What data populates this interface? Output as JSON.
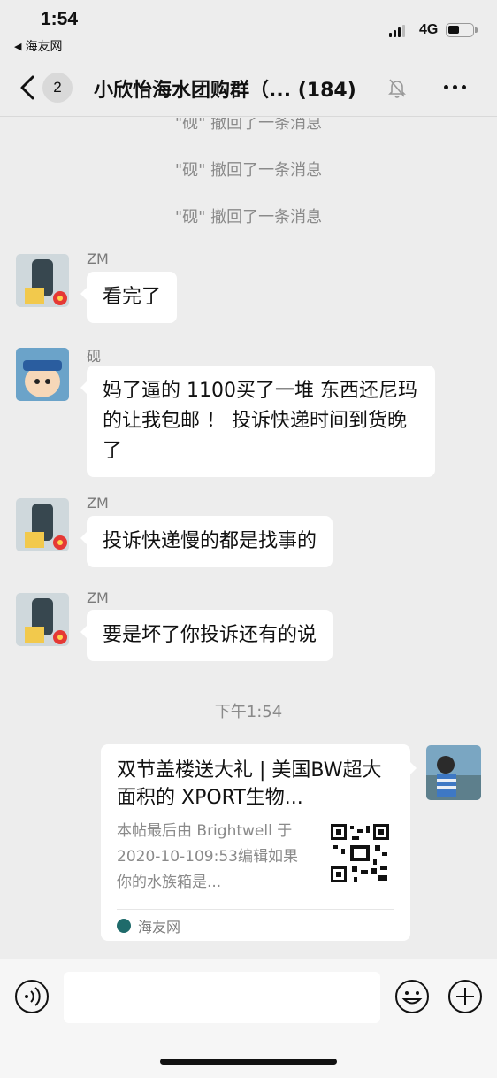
{
  "status_bar": {
    "time": "1:54",
    "back_app": "海友网",
    "network": "4G",
    "battery_level": 0.4
  },
  "nav": {
    "unread_count": "2",
    "title": "小欣怡海水团购群（... (184)",
    "muted": true
  },
  "messages": {
    "recall_1": "\"砚\" 撤回了一条消息",
    "recall_2": "\"砚\" 撤回了一条消息",
    "recall_3": "\"砚\" 撤回了一条消息",
    "m1": {
      "sender": "ZM",
      "text": "看完了"
    },
    "m2": {
      "sender": "砚",
      "text": "妈了逼的 1100买了一堆 东西还尼玛的让我包邮 ！ 投诉快递时间到货晚了"
    },
    "m3": {
      "sender": "ZM",
      "text": "投诉快递慢的都是找事的"
    },
    "m4": {
      "sender": "ZM",
      "text": "要是坏了你投诉还有的说"
    },
    "timestamp": "下午1:54",
    "link_card": {
      "title": "双节盖楼送大礼 | 美国BW超大面积的 XPORT生物...",
      "description": "本帖最后由 Brightwell 于 2020-10-109:53编辑如果你的水族箱是...",
      "source": "海友网"
    }
  },
  "input": {
    "value": "",
    "placeholder": ""
  },
  "colors": {
    "background": "#ededed",
    "bubble": "#ffffff",
    "system_text": "#8a8a8a"
  },
  "icons": [
    "back-arrow-icon",
    "bell-off-icon",
    "more-icon",
    "voice-icon",
    "emoji-icon",
    "plus-icon"
  ]
}
